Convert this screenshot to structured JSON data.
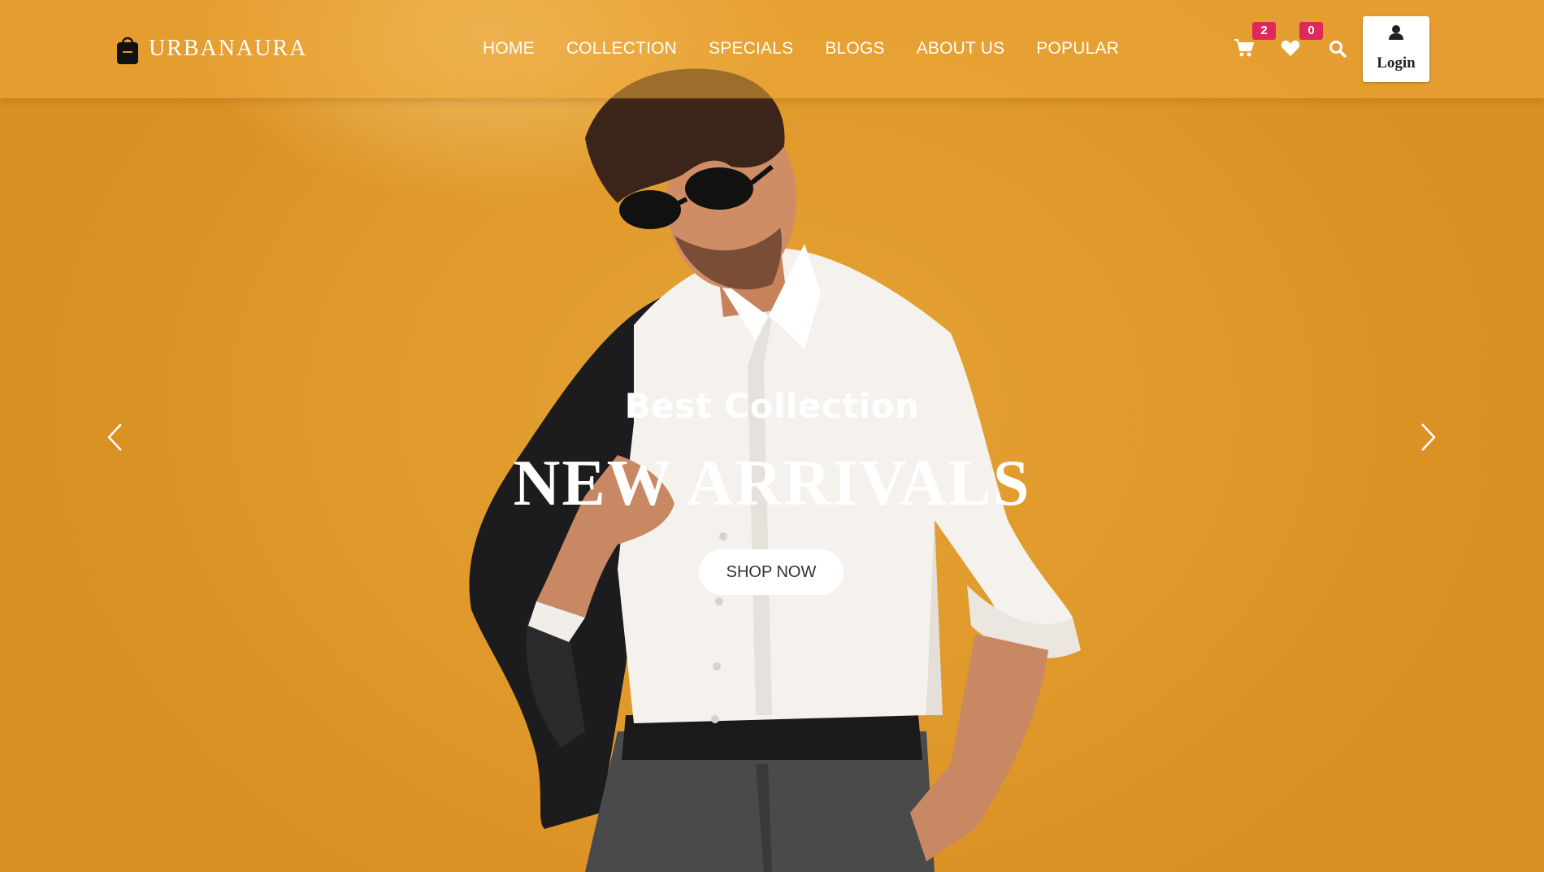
{
  "brand": {
    "name": "URBANAURA"
  },
  "nav": {
    "items": [
      {
        "label": "HOME"
      },
      {
        "label": "COLLECTION"
      },
      {
        "label": "SPECIALS"
      },
      {
        "label": "BLOGS"
      },
      {
        "label": "ABOUT US"
      },
      {
        "label": "POPULAR"
      }
    ]
  },
  "header_icons": {
    "cart_count": "2",
    "wishlist_count": "0",
    "login_label": "Login",
    "icons": [
      "cart-icon",
      "heart-icon",
      "search-icon",
      "user-icon"
    ]
  },
  "hero": {
    "subtitle": "Best Collection",
    "title": "NEW ARRIVALS",
    "cta_label": "SHOP NOW",
    "prev_icon": "chevron-left-icon",
    "next_icon": "chevron-right-icon"
  },
  "colors": {
    "background": "#e29a2c",
    "badge": "#e0285a",
    "text": "#ffffff"
  }
}
